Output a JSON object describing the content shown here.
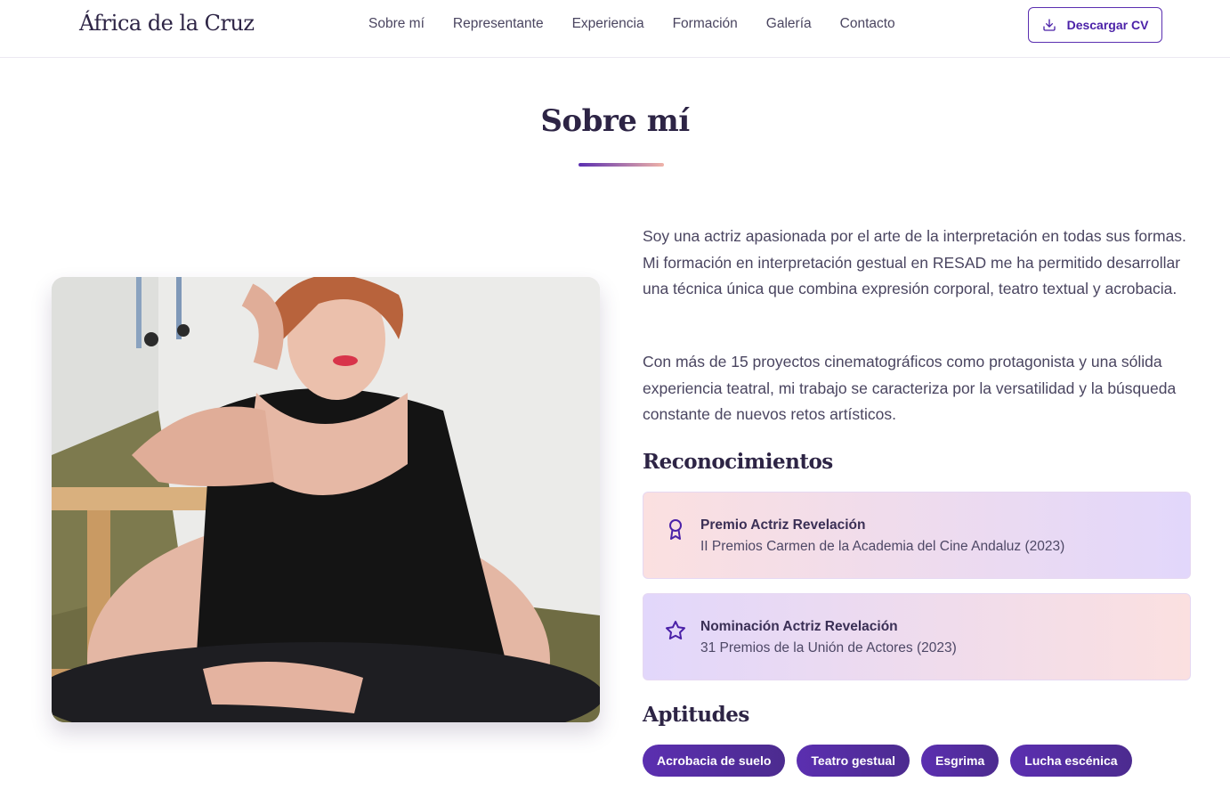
{
  "header": {
    "brand": "África de la Cruz",
    "nav": [
      "Sobre mí",
      "Representante",
      "Experiencia",
      "Formación",
      "Galería",
      "Contacto"
    ],
    "cv_button": "Descargar CV",
    "cv_icon": "download-icon"
  },
  "about": {
    "title": "Sobre mí",
    "bio": [
      "Soy una actriz apasionada por el arte de la interpretación en todas sus formas. Mi formación en interpretación gestual en RESAD me ha permitido desarrollar una técnica única que combina expresión corporal, teatro textual y acrobacia.",
      "Con más de 15 proyectos cinematográficos como protagonista y una sólida experiencia teatral, mi trabajo se caracteriza por la versatilidad y la búsqueda constante de nuevos retos artísticos."
    ],
    "awards_heading": "Reconocimientos",
    "awards": [
      {
        "title": "Premio Actriz Revelación",
        "subtitle": "II Premios Carmen de la Academia del Cine Andaluz (2023)",
        "icon": "award-ribbon-icon"
      },
      {
        "title": "Nominación Actriz Revelación",
        "subtitle": "31 Premios de la Unión de Actores (2023)",
        "icon": "star-icon"
      }
    ],
    "skills_heading": "Aptitudes",
    "skills": [
      "Acrobacia de suelo",
      "Teatro gestual",
      "Esgrima",
      "Lucha escénica"
    ]
  },
  "colors": {
    "accent": "#5b2fb0",
    "heading": "#2d2445",
    "text": "#4a4560",
    "award_pink": "#fbe0e0",
    "award_lavender": "#e2d7fb"
  }
}
